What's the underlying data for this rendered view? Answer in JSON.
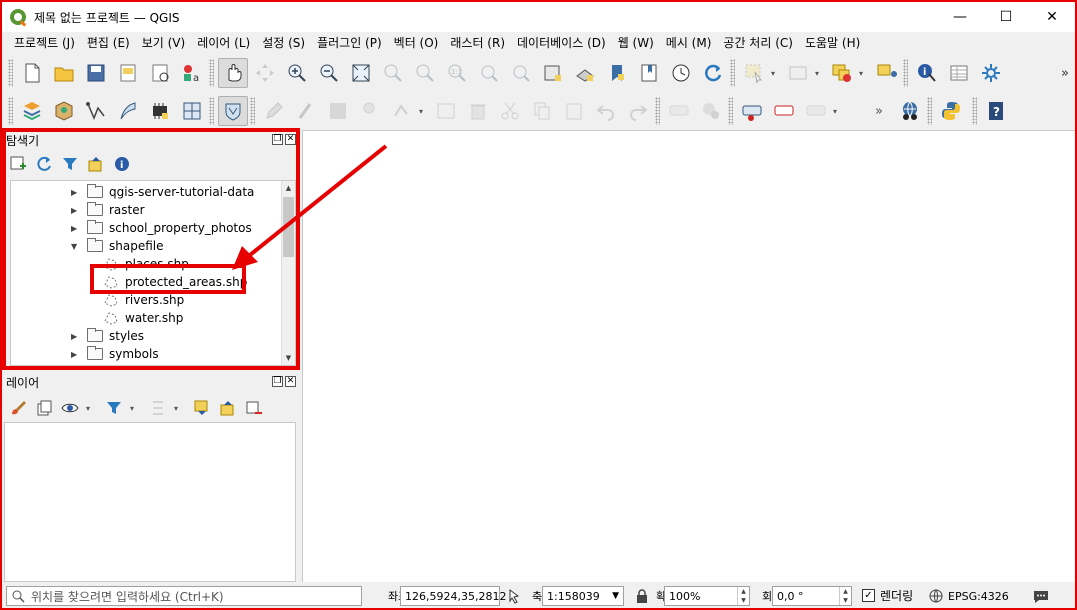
{
  "window": {
    "title": "제목 없는 프로젝트 — QGIS",
    "minimize": "—",
    "maximize": "☐",
    "close": "✕"
  },
  "menu": [
    "프로젝트 (J)",
    "편집 (E)",
    "보기 (V)",
    "레이어 (L)",
    "설정 (S)",
    "플러그인 (P)",
    "벡터 (O)",
    "래스터 (R)",
    "데이터베이스 (D)",
    "웹 (W)",
    "메시 (M)",
    "공간 처리 (C)",
    "도움말 (H)"
  ],
  "toolbar": {
    "more": "»"
  },
  "browser_panel": {
    "title": "탐색기",
    "items": [
      {
        "label": "qgis-server-tutorial-data",
        "type": "folder",
        "state": "collapsed"
      },
      {
        "label": "raster",
        "type": "folder",
        "state": "collapsed"
      },
      {
        "label": "school_property_photos",
        "type": "folder",
        "state": "collapsed"
      },
      {
        "label": "shapefile",
        "type": "folder",
        "state": "expanded"
      },
      {
        "label": "places.shp",
        "type": "shapefile"
      },
      {
        "label": "protected_areas.shp",
        "type": "shapefile",
        "highlighted": true
      },
      {
        "label": "rivers.shp",
        "type": "shapefile"
      },
      {
        "label": "water.shp",
        "type": "shapefile"
      },
      {
        "label": "styles",
        "type": "folder",
        "state": "collapsed"
      },
      {
        "label": "symbols",
        "type": "folder",
        "state": "collapsed"
      }
    ]
  },
  "layers_panel": {
    "title": "레이어"
  },
  "statusbar": {
    "locator_placeholder": "위치를 찾으려면 입력하세요 (Ctrl+K)",
    "coordinate_label": "좌표",
    "coordinate": "126,5924,35,2812",
    "scale_label": "축척",
    "scale": "1:158039",
    "magnifier_label": "확대",
    "magnifier": "100%",
    "rotation_label": "회전",
    "rotation": "0,0 °",
    "render_label": "렌더링",
    "render_checked": "✓",
    "crs": "EPSG:4326"
  },
  "colors": {
    "highlight": "#e60000",
    "qgis_green": "#589632",
    "qgis_orange": "#ee7913"
  }
}
